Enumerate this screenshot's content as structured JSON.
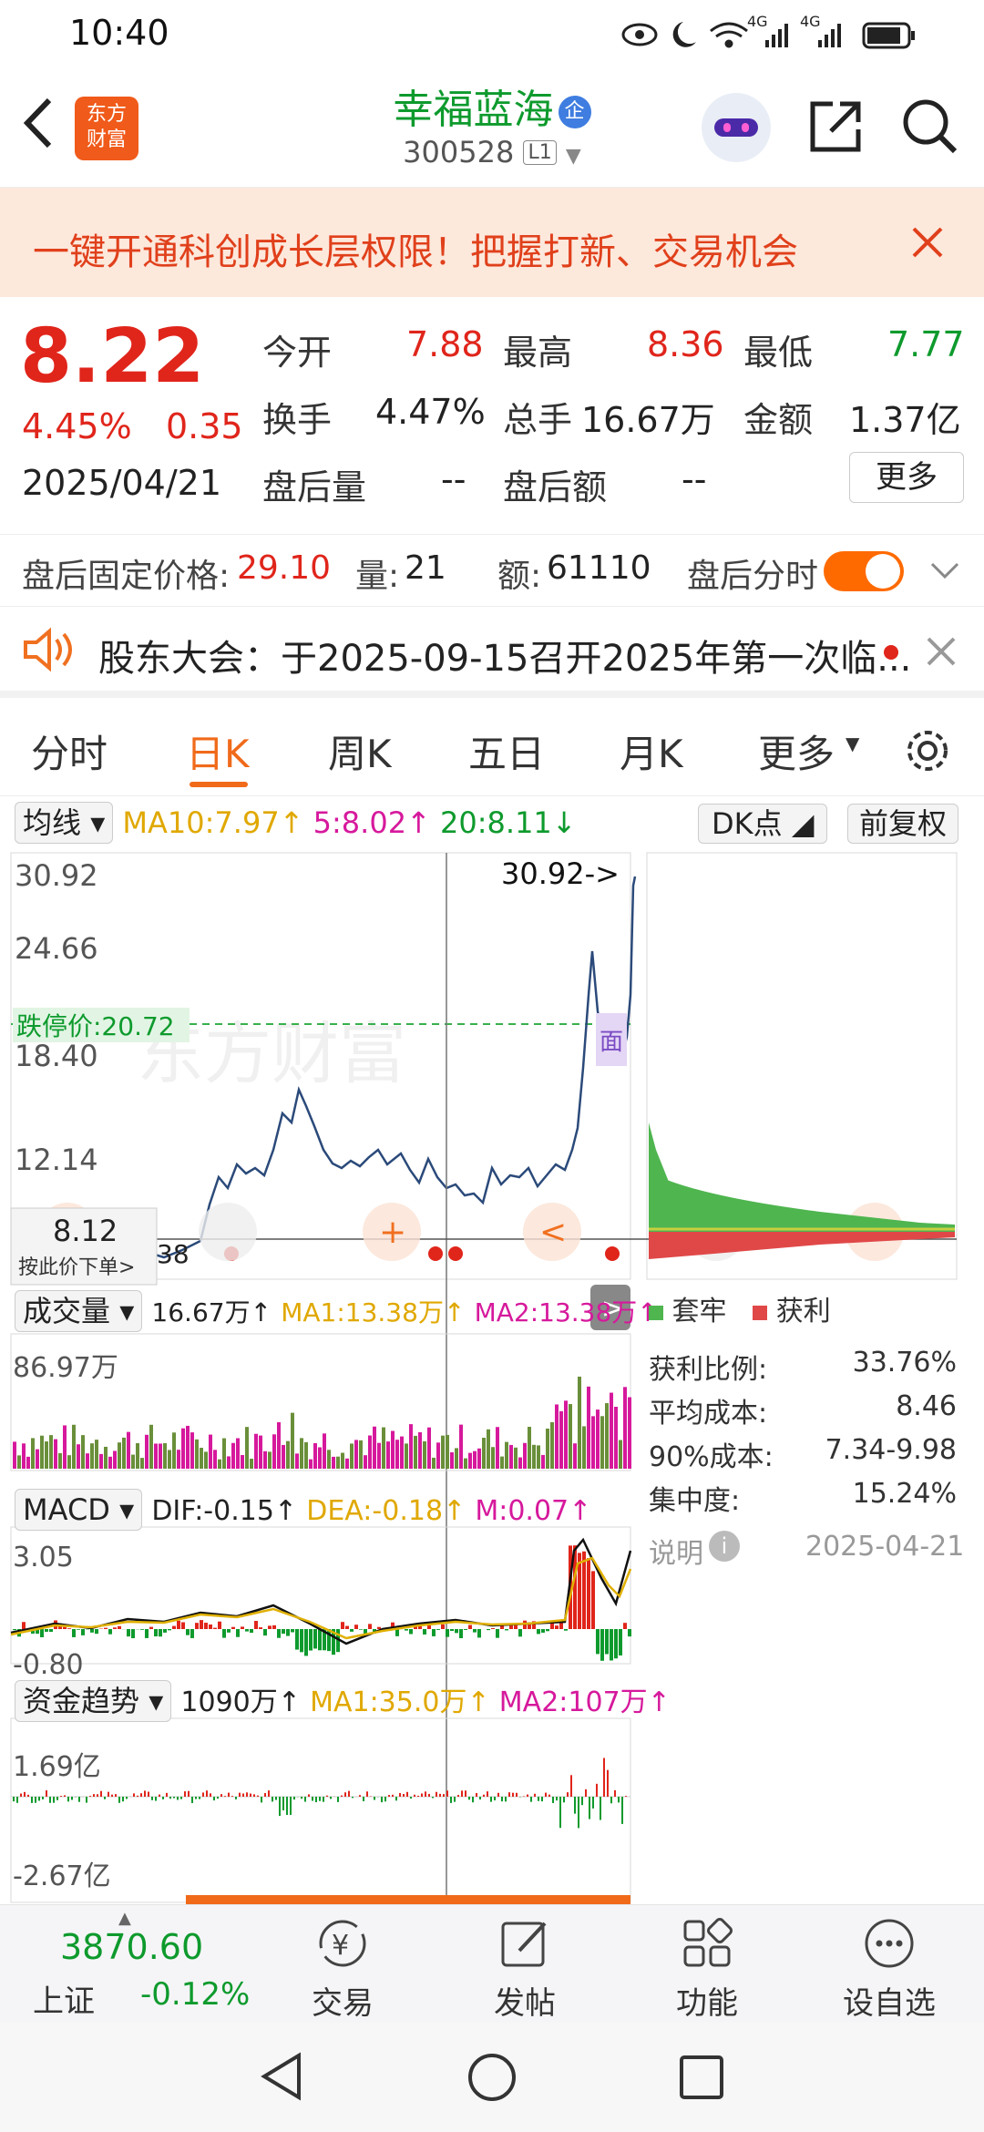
{
  "status": {
    "time": "10:40",
    "signal1": "4G",
    "signal2": "4G"
  },
  "header": {
    "logo_line1": "东方",
    "logo_line2": "财富",
    "stock_name": "幸福蓝海",
    "badge": "企",
    "stock_code": "300528",
    "level": "L1"
  },
  "banner": {
    "text": "一键开通科创成长层权限！把握打新、交易机会"
  },
  "quote": {
    "price": "8.22",
    "change_pct": "4.45%",
    "change": "0.35",
    "date": "2025/04/21",
    "open_label": "今开",
    "open": "7.88",
    "high_label": "最高",
    "high": "8.36",
    "low_label": "最低",
    "low": "7.77",
    "turnover_label": "换手",
    "turnover": "4.47%",
    "volume_label": "总手",
    "volume": "16.67万",
    "amount_label": "金额",
    "amount": "1.37亿",
    "after_vol_label": "盘后量",
    "after_vol": "--",
    "after_amt_label": "盘后额",
    "after_amt": "--",
    "more": "更多"
  },
  "after_hours": {
    "price_label": "盘后固定价格:",
    "price": "29.10",
    "vol_label": "量:",
    "vol": "21",
    "amt_label": "额:",
    "amt": "61110",
    "toggle_label": "盘后分时",
    "toggle_on": true
  },
  "notice": {
    "text": "股东大会：于2025-09-15召开2025年第一次临..."
  },
  "tabs": [
    "分时",
    "日K",
    "周K",
    "五日",
    "月K",
    "更多"
  ],
  "active_tab": "日K",
  "kline": {
    "ma_select": "均线",
    "ma10": "MA10:7.97↑",
    "ma5": "5:8.02↑",
    "ma20": "20:8.11↓",
    "dk_btn": "DK点",
    "fq_btn": "前复权",
    "y_max": "30.92",
    "y2": "24.66",
    "y3": "18.40",
    "y4": "12.14",
    "max_marker": "30.92->",
    "limit_down": "跌停价:20.72",
    "cursor_price": "8.12",
    "cursor_hint": "按此价下单>",
    "partial_label": "38",
    "watermark": "东方财富",
    "marker_char": "面"
  },
  "volume": {
    "select": "成交量",
    "value": "16.67万↑",
    "ma1": "MA1:13.38万↑",
    "ma2": "MA2:13.38万↑",
    "y_max": "86.97万"
  },
  "macd": {
    "select": "MACD",
    "dif": "DIF:-0.15↑",
    "dea": "DEA:-0.18↑",
    "m": "M:0.07↑",
    "y_max": "3.05",
    "y_min": "-0.80"
  },
  "flow": {
    "select": "资金趋势",
    "value": "1090万↑",
    "ma1": "MA1:35.0万↑",
    "ma2": "MA2:107万↑",
    "y_max": "1.69亿",
    "y_min": "-2.67亿"
  },
  "chips": {
    "legend_trap": "套牢",
    "legend_profit": "获利",
    "rows": [
      {
        "label": "获利比例:",
        "value": "33.76%"
      },
      {
        "label": "平均成本:",
        "value": "8.46"
      },
      {
        "label": "90%成本:",
        "value": "7.34-9.98"
      },
      {
        "label": "集中度:",
        "value": "15.24%"
      }
    ],
    "note_label": "说明",
    "note_date": "2025-04-21"
  },
  "bottom": {
    "index_value": "3870.60",
    "index_name": "上证",
    "index_change": "-0.12%",
    "nav": [
      "交易",
      "发帖",
      "功能",
      "设自选"
    ]
  },
  "colors": {
    "up": "#e0251b",
    "down": "#0e9a2d",
    "accent": "#ff6a00",
    "price_line": "#2b4a7a"
  }
}
